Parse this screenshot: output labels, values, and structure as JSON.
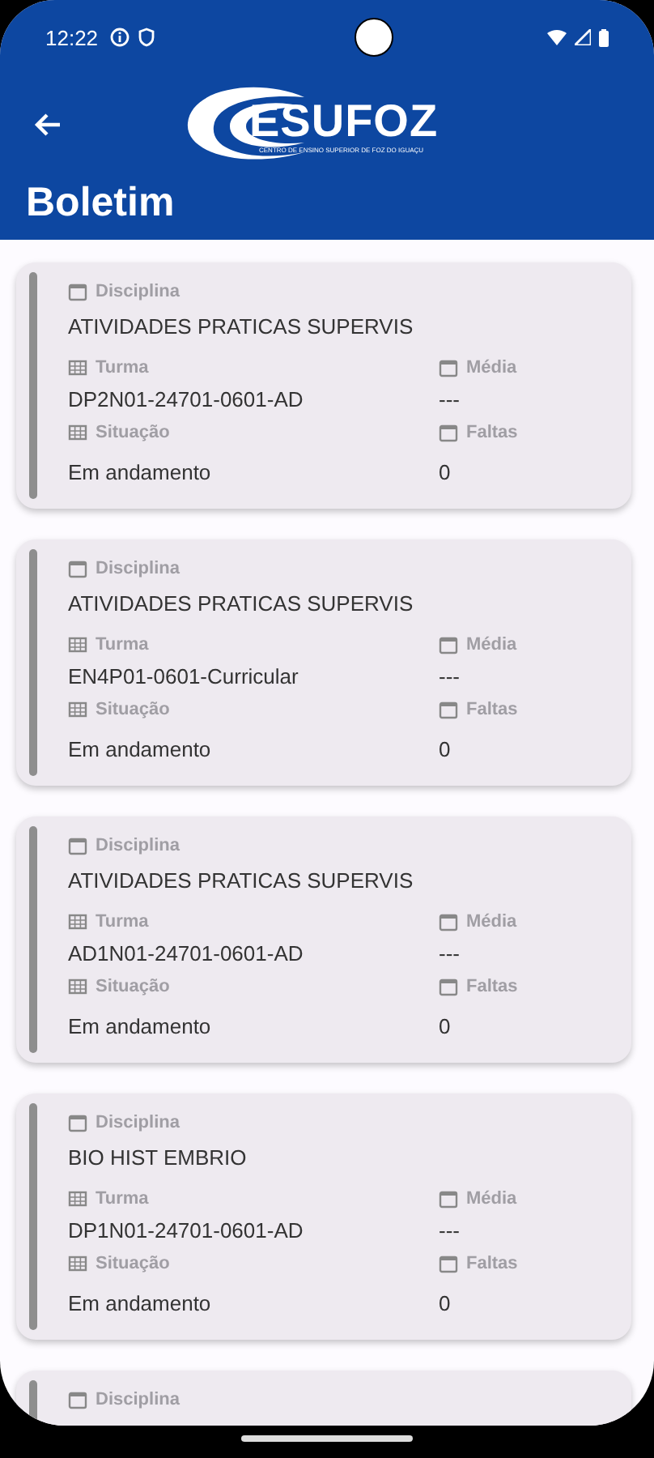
{
  "status_bar": {
    "time": "12:22"
  },
  "header": {
    "logo_text": "ESUFOZ",
    "logo_subtitle": "CENTRO DE ENSINO SUPERIOR DE FOZ DO IGUAÇU",
    "title": "Boletim"
  },
  "cards": [
    {
      "discipline_label": "Disciplina",
      "discipline": "ATIVIDADES PRATICAS SUPERVIS",
      "fields": [
        {
          "label": "Turma",
          "value": "DP2N01-24701-0601-AD",
          "kind": "grid"
        },
        {
          "label": "Média",
          "value": "---",
          "kind": "calendar"
        },
        {
          "label": "Situação",
          "value": "Em andamento",
          "kind": "grid"
        },
        {
          "label": "Faltas",
          "value": "0",
          "kind": "calendar"
        }
      ]
    },
    {
      "discipline_label": "Disciplina",
      "discipline": "ATIVIDADES PRATICAS SUPERVIS",
      "fields": [
        {
          "label": "Turma",
          "value": "EN4P01-0601-Curricular",
          "kind": "grid"
        },
        {
          "label": "Média",
          "value": "---",
          "kind": "calendar"
        },
        {
          "label": "Situação",
          "value": "Em andamento",
          "kind": "grid"
        },
        {
          "label": "Faltas",
          "value": "0",
          "kind": "calendar"
        }
      ]
    },
    {
      "discipline_label": "Disciplina",
      "discipline": "ATIVIDADES PRATICAS SUPERVIS",
      "fields": [
        {
          "label": "Turma",
          "value": "AD1N01-24701-0601-AD",
          "kind": "grid"
        },
        {
          "label": "Média",
          "value": "---",
          "kind": "calendar"
        },
        {
          "label": "Situação",
          "value": "Em andamento",
          "kind": "grid"
        },
        {
          "label": "Faltas",
          "value": "0",
          "kind": "calendar"
        }
      ]
    },
    {
      "discipline_label": "Disciplina",
      "discipline": "BIO HIST EMBRIO",
      "fields": [
        {
          "label": "Turma",
          "value": "DP1N01-24701-0601-AD",
          "kind": "grid"
        },
        {
          "label": "Média",
          "value": "---",
          "kind": "calendar"
        },
        {
          "label": "Situação",
          "value": "Em andamento",
          "kind": "grid"
        },
        {
          "label": "Faltas",
          "value": "0",
          "kind": "calendar"
        }
      ]
    },
    {
      "discipline_label": "Disciplina"
    }
  ]
}
